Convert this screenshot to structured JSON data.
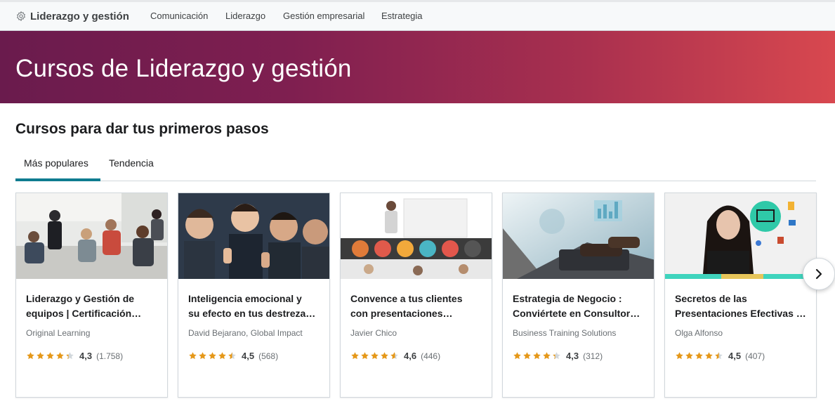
{
  "topnav": {
    "brand": "Liderazgo y gestión",
    "items": [
      "Comunicación",
      "Liderazgo",
      "Gestión empresarial",
      "Estrategia"
    ]
  },
  "hero": {
    "title": "Cursos de Liderazgo y gestión"
  },
  "section": {
    "title": "Cursos para dar tus primeros pasos",
    "tabs": [
      {
        "label": "Más populares",
        "active": true
      },
      {
        "label": "Tendencia",
        "active": false
      }
    ]
  },
  "courses": [
    {
      "title_line1": "Liderazgo y Gestión de",
      "title_line2": "equipos | Certificación…",
      "author": "Original Learning",
      "rating": "4,3",
      "rating_value": 4.3,
      "count": "(1.758)"
    },
    {
      "title_line1": "Inteligencia emocional y",
      "title_line2": "su efecto en tus destreza…",
      "author": "David Bejarano, Global Impact",
      "rating": "4,5",
      "rating_value": 4.5,
      "count": "(568)"
    },
    {
      "title_line1": "Convence a tus clientes",
      "title_line2": "con presentaciones…",
      "author": "Javier Chico",
      "rating": "4,6",
      "rating_value": 4.6,
      "count": "(446)"
    },
    {
      "title_line1": "Estrategia de Negocio :",
      "title_line2": "Conviértete en Consultor…",
      "author": "Business Training Solutions",
      "rating": "4,3",
      "rating_value": 4.3,
      "count": "(312)"
    },
    {
      "title_line1": "Secretos de las",
      "title_line2": "Presentaciones Efectivas …",
      "author": "Olga Alfonso",
      "rating": "4,5",
      "rating_value": 4.5,
      "count": "(407)"
    }
  ],
  "colors": {
    "accent": "#0f7c90",
    "star": "#e59819",
    "hero_start": "#6a1b4d",
    "hero_end": "#d8484f"
  },
  "icons": {
    "brand": "gear-icon",
    "next": "chevron-right-icon",
    "rating": "star-icon"
  }
}
